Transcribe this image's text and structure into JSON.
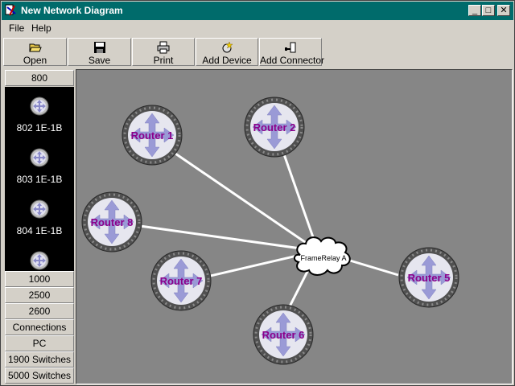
{
  "window": {
    "title": "New Network Diagram"
  },
  "title_buttons": {
    "minimize": "_",
    "maximize": "□",
    "close": "✕"
  },
  "menu": [
    "File",
    "Help"
  ],
  "toolbar": {
    "open_label": "Open",
    "save_label": "Save",
    "print_label": "Print",
    "add_device_label": "Add Device",
    "add_connector_label": "Add Connector"
  },
  "sidebar": {
    "active_group": "800",
    "active_items": [
      "802 1E-1B",
      "803 1E-1B",
      "804 1E-1B"
    ],
    "groups": [
      "1000",
      "2500",
      "2600",
      "Connections",
      "PC",
      "1900 Switches",
      "5000 Switches"
    ]
  },
  "diagram": {
    "routers": [
      "Router 1",
      "Router 2",
      "Router 8",
      "Router 7",
      "Router 6",
      "Router 5"
    ],
    "cloud": "FrameRelay A",
    "connections": [
      [
        "Router 1",
        "FrameRelay A"
      ],
      [
        "Router 2",
        "FrameRelay A"
      ],
      [
        "Router 8",
        "FrameRelay A"
      ],
      [
        "Router 7",
        "FrameRelay A"
      ],
      [
        "Router 6",
        "FrameRelay A"
      ],
      [
        "Router 5",
        "FrameRelay A"
      ]
    ]
  },
  "colors": {
    "titlebar": "#006b6b",
    "canvas": "#868686",
    "router_label": "#8b008b",
    "sidebar_panel": "#000000"
  }
}
